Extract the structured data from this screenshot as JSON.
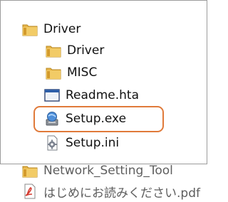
{
  "tree": {
    "root": {
      "label": "Driver",
      "icon": "folder-icon"
    },
    "children": [
      {
        "label": "Driver",
        "icon": "folder-icon"
      },
      {
        "label": "MISC",
        "icon": "folder-icon"
      },
      {
        "label": "Readme.hta",
        "icon": "window-app-icon"
      },
      {
        "label": "Setup.exe",
        "icon": "setup-installer-icon",
        "highlighted": true
      },
      {
        "label": "Setup.ini",
        "icon": "settings-file-icon"
      }
    ],
    "siblings": [
      {
        "label": "Network_Setting_Tool",
        "icon": "folder-icon"
      },
      {
        "label": "はじめにお読みください.pdf",
        "icon": "pdf-file-icon"
      }
    ]
  },
  "colors": {
    "highlight_border": "#e07a3a",
    "folder": "#e6b44a",
    "frame_border": "#9c9c9c"
  }
}
